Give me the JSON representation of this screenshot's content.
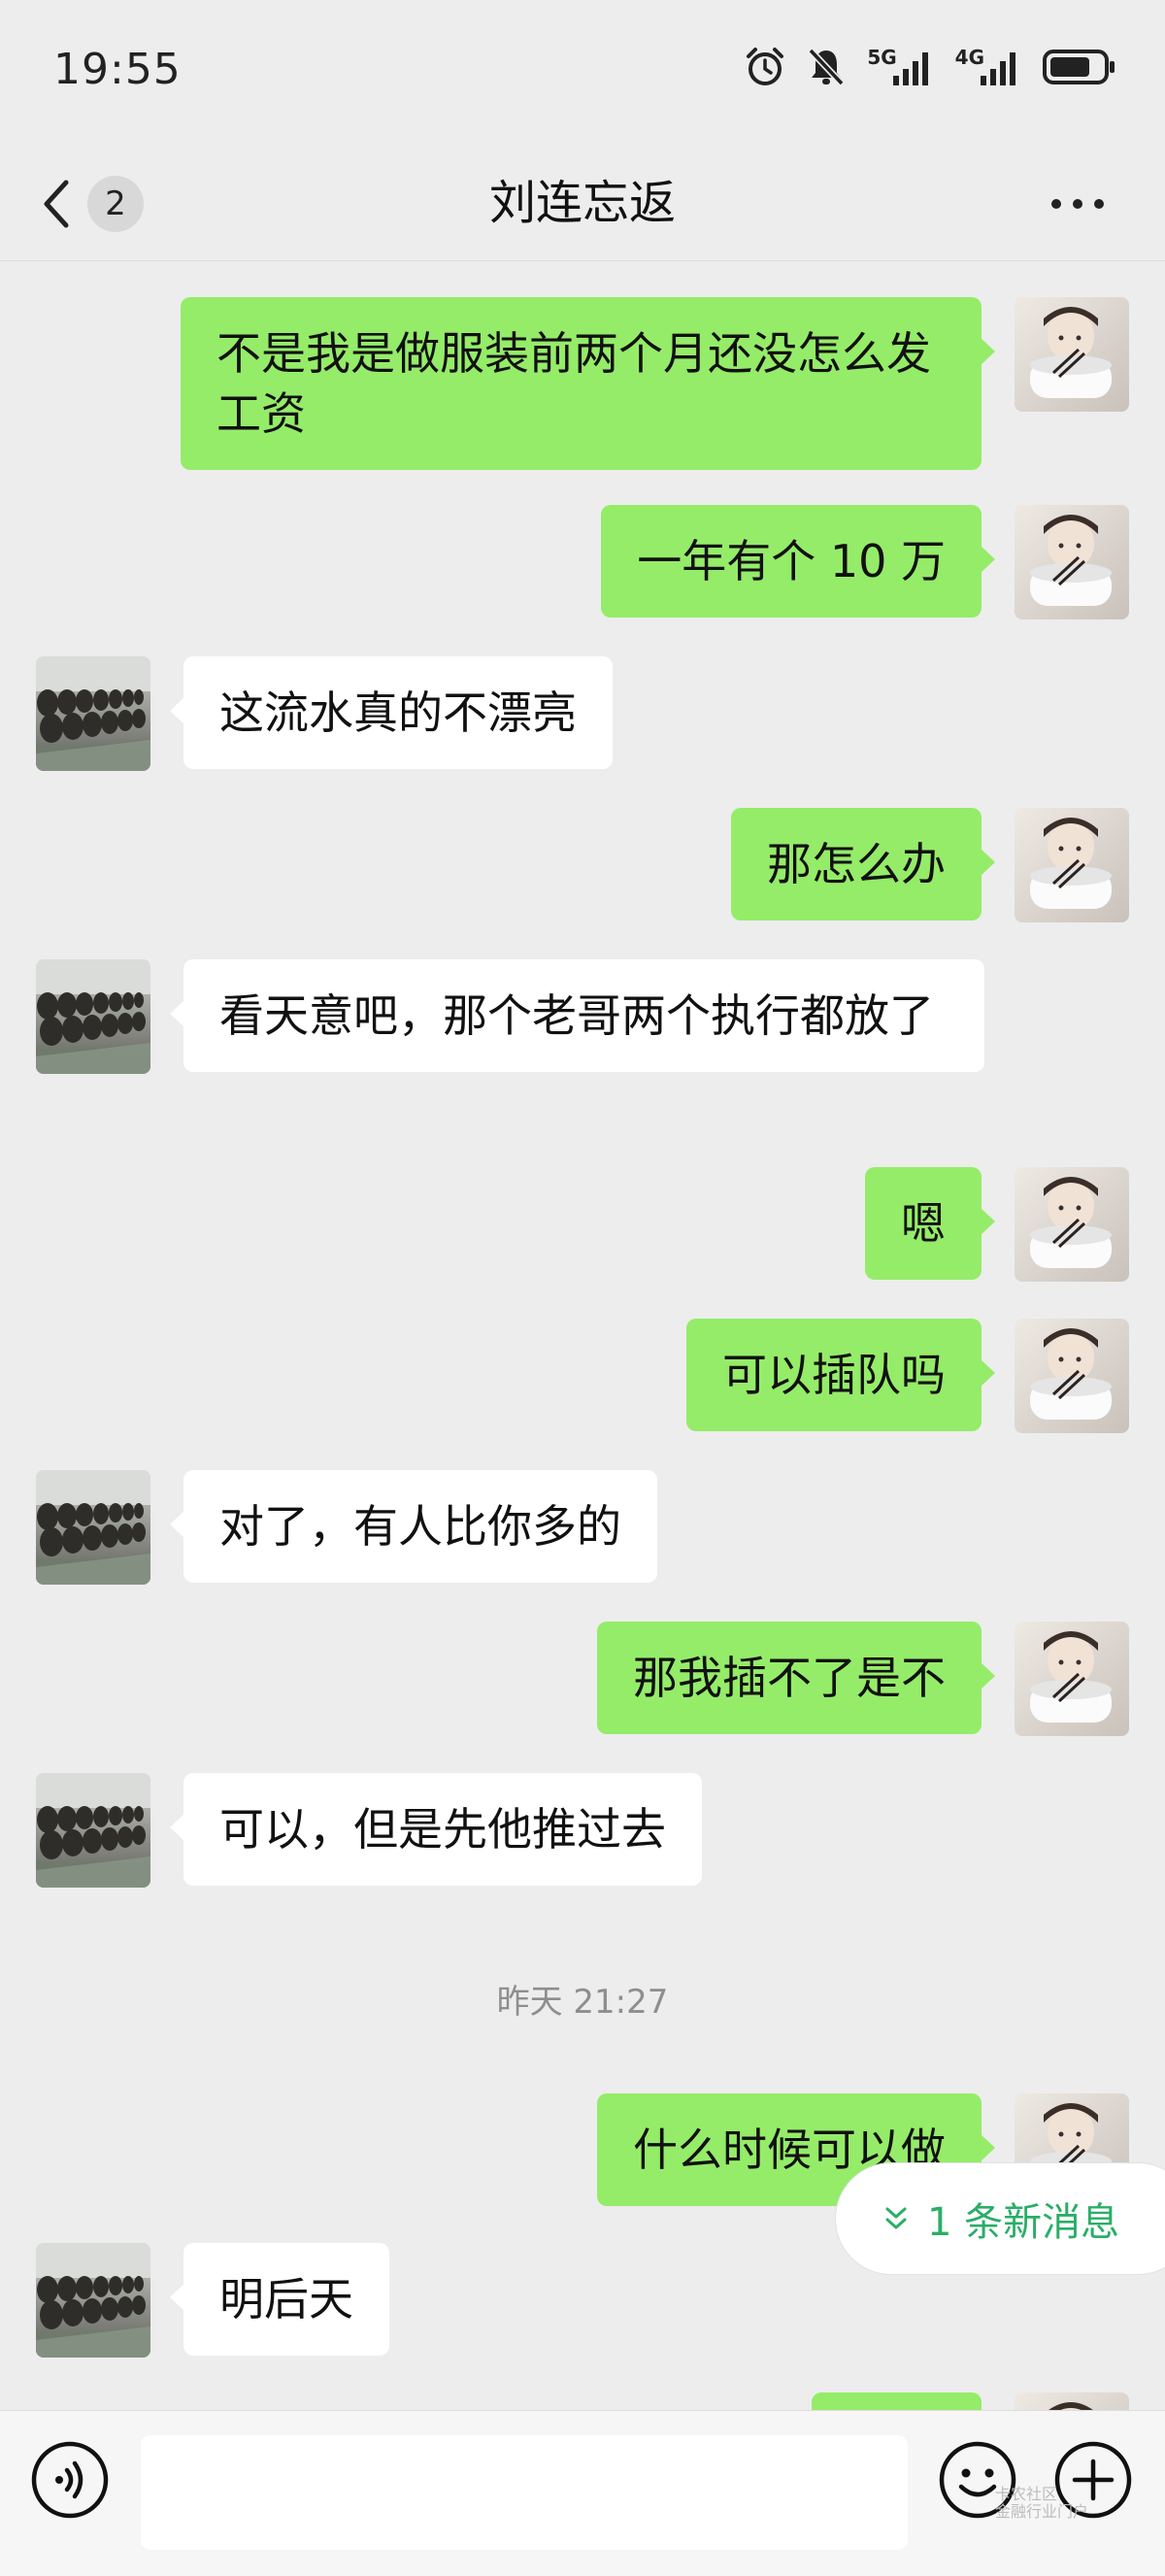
{
  "status_bar": {
    "time": "19:55",
    "net1": "5G",
    "net2": "4G",
    "icons": [
      "alarm-icon",
      "mute-bell-icon",
      "signal-5g-icon",
      "signal-4g-icon",
      "battery-icon"
    ]
  },
  "nav": {
    "unread_count": "2",
    "title": "刘连忘返",
    "back_icon": "chevron-left-icon",
    "more_icon": "more-dots-icon"
  },
  "messages": [
    {
      "from": "me",
      "text": "不是我是做服装前两个月还没怎么发工资"
    },
    {
      "from": "me",
      "text": "一年有个 10 万"
    },
    {
      "from": "other",
      "text": "这流水真的不漂亮"
    },
    {
      "from": "me",
      "text": "那怎么办"
    },
    {
      "from": "other",
      "text": "看天意吧，那个老哥两个执行都放了"
    },
    {
      "from": "me",
      "text": "嗯"
    },
    {
      "from": "me",
      "text": "可以插队吗"
    },
    {
      "from": "other",
      "text": "对了，有人比你多的"
    },
    {
      "from": "me",
      "text": "那我插不了是不"
    },
    {
      "from": "other",
      "text": "可以，但是先他推过去"
    },
    {
      "from": "me",
      "text": "什么时候可以做"
    },
    {
      "from": "other",
      "text": "明后天"
    }
  ],
  "timestamp": "昨天 21:27",
  "new_message_pill": "1 条新消息",
  "colors": {
    "background": "#ededed",
    "outgoing_bubble": "#95ec69",
    "incoming_bubble": "#ffffff",
    "accent_green": "#2aae67"
  },
  "input_bar": {
    "voice_icon": "voice-icon",
    "emoji_icon": "emoji-icon",
    "plus_icon": "plus-icon"
  },
  "watermark": {
    "line1": "卡农社区",
    "line2": "金融行业门户"
  }
}
